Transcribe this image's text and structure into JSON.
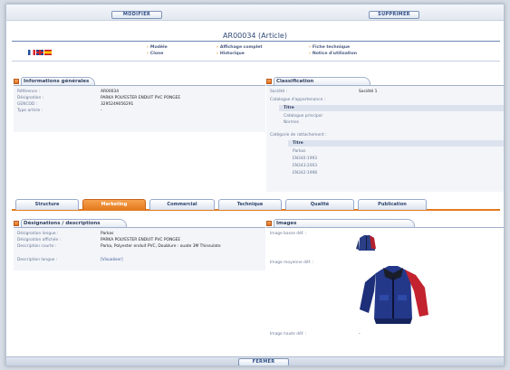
{
  "toolbar": {
    "modify_label": "MODIFIER",
    "delete_label": "SUPPRIMER"
  },
  "header": {
    "title": "AR00034 (Article)"
  },
  "links": {
    "modele": "Modèle",
    "clone": "Clone",
    "affichage_complet": "Affichage complet",
    "historique": "Historique",
    "fiche_technique": "Fiche technique",
    "notice": "Notice d'utilisation"
  },
  "general": {
    "title": "Informations générales",
    "rows": [
      {
        "label": "Référence :",
        "value": "AR00034"
      },
      {
        "label": "Désignation :",
        "value": "PARKA POLYESTER ENDUIT PVC PONGEE"
      },
      {
        "label": "GENCOD :",
        "value": "3295249056291"
      },
      {
        "label": "Type article :",
        "value": "-"
      }
    ]
  },
  "classification": {
    "title": "Classification",
    "societe_label": "Société :",
    "societe_value": "Société 1",
    "catalogue_label": "Catalogue d'appartenance :",
    "catalogue_title": "Titre",
    "catalogue_items": [
      "Catalogue principal",
      "Normes"
    ],
    "rattachement_label": "Catégorie de rattachement :",
    "rattachement_title": "Titre",
    "rattachement_items": [
      "Parkas",
      "EN340:1993",
      "EN343:2003",
      "EN342:1998"
    ]
  },
  "tabs": [
    "Structure",
    "Marketing",
    "Commercial",
    "Technique",
    "Qualité",
    "Publication"
  ],
  "designations": {
    "title": "Désignations / descriptions",
    "rows": [
      {
        "label": "Désignation longue :",
        "value": "Parkas"
      },
      {
        "label": "Désignation affichée :",
        "value": "PARKA POLYESTER ENDUIT PVC PONGEE"
      },
      {
        "label": "Description courte :",
        "value": "Parka, Polyester enduit PVC, Doublure : ouate 3M Thinsulate"
      },
      {
        "label": "Description longue :",
        "value": "[Visualiser]"
      }
    ]
  },
  "images": {
    "title": "Images",
    "base_label": "Image basse déf. :",
    "moyenne_label": "Image moyenne déf. :",
    "haute_label": "Image haute déf. :",
    "haute_value": "-"
  },
  "footer": {
    "close_label": "FERMER"
  },
  "colors": {
    "accent": "#e27a1f",
    "border": "#9fb0cc",
    "title": "#2f4a78"
  }
}
